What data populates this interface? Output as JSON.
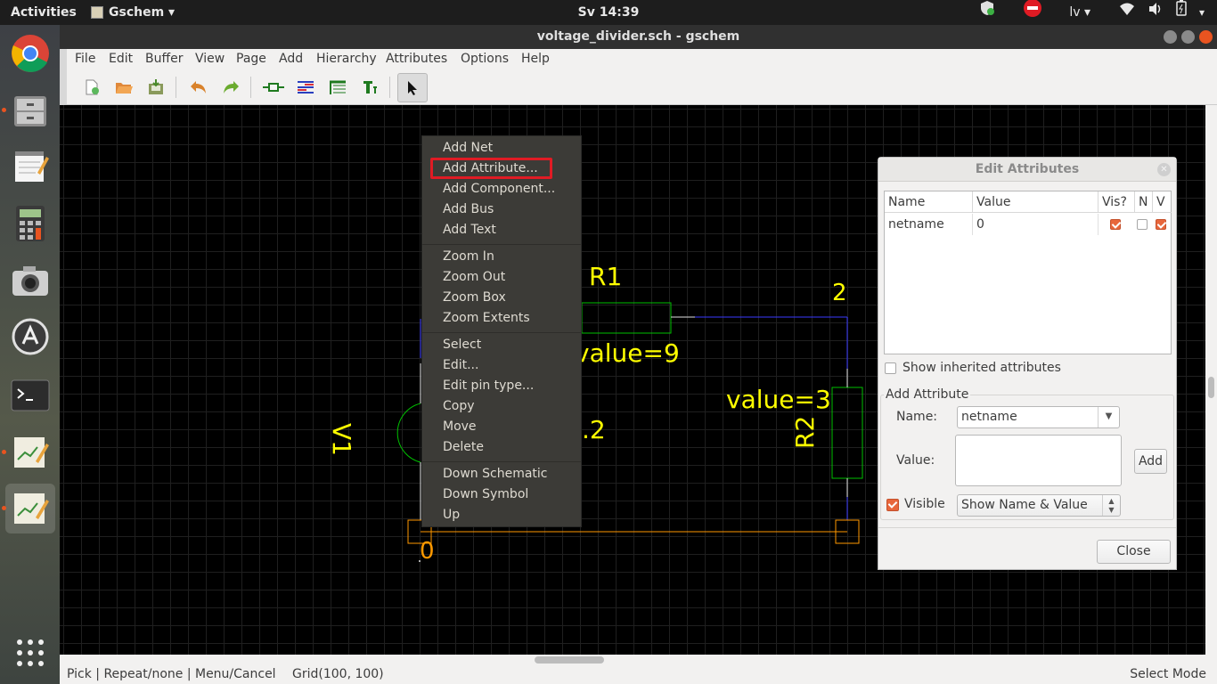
{
  "topbar": {
    "activities": "Activities",
    "app_menu": "Gschem ▾",
    "clock": "Sv 14:39",
    "language": "lv ▾"
  },
  "window": {
    "title": "voltage_divider.sch - gschem"
  },
  "menubar": {
    "items": [
      "File",
      "Edit",
      "Buffer",
      "View",
      "Page",
      "Add",
      "Hierarchy",
      "Attributes",
      "Options",
      "Help"
    ]
  },
  "toolbar": {
    "icons": [
      "new-file-icon",
      "open-file-icon",
      "save-file-icon",
      "undo-icon",
      "redo-icon",
      "add-component-icon",
      "add-net-icon",
      "add-bus-icon",
      "add-text-icon",
      "select-pointer-icon"
    ]
  },
  "schematic": {
    "r1_label": "R1",
    "r1_value": "value=9",
    "r2_label": "R2",
    "r2_value": "value=3",
    "v1_label": "V1",
    "v1_value_partial": ".2",
    "net_2_label": "2",
    "net_0_label": "0"
  },
  "context_menu": {
    "group1": [
      "Add Net",
      "Add Attribute...",
      "Add Component...",
      "Add Bus",
      "Add Text"
    ],
    "group2": [
      "Zoom In",
      "Zoom Out",
      "Zoom Box",
      "Zoom Extents"
    ],
    "group3": [
      "Select",
      "Edit...",
      "Edit pin type...",
      "Copy",
      "Move",
      "Delete"
    ],
    "group4": [
      "Down Schematic",
      "Down Symbol",
      "Up"
    ]
  },
  "edit_attributes": {
    "title": "Edit Attributes",
    "columns": [
      "Name",
      "Value",
      "Vis?",
      "N",
      "V"
    ],
    "rows": [
      {
        "name": "netname",
        "value": "0",
        "vis": true,
        "n": false,
        "v": true
      }
    ],
    "show_inherited_label": "Show inherited attributes",
    "add_attribute_heading": "Add Attribute",
    "name_label": "Name:",
    "name_value": "netname",
    "value_label": "Value:",
    "add_button": "Add",
    "visible_label": "Visible",
    "visibility_option": "Show Name & Value",
    "close_button": "Close"
  },
  "statusbar": {
    "mouse_help": "Pick | Repeat/none | Menu/Cancel",
    "grid": "Grid(100, 100)",
    "mode": "Select Mode"
  },
  "colors": {
    "highlight_box": "#e01b24",
    "component": "#00c000",
    "net": "#0000ff",
    "text": "#ffff00",
    "selection": "#ff9900"
  }
}
